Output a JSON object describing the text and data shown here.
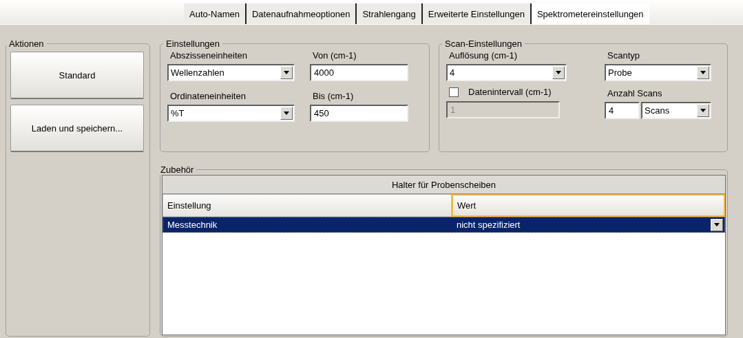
{
  "tabs": [
    {
      "label": "Auto-Namen",
      "selected": false
    },
    {
      "label": "Datenaufnahmeoptionen",
      "selected": false
    },
    {
      "label": "Strahlengang",
      "selected": false
    },
    {
      "label": "Erweiterte Einstellungen",
      "selected": false
    },
    {
      "label": "Spektrometereinstellungen",
      "selected": true
    }
  ],
  "actions": {
    "title": "Aktionen",
    "buttons": [
      "Standard",
      "Laden und speichern..."
    ]
  },
  "einstellungen": {
    "title": "Einstellungen",
    "fields": [
      {
        "kind": "select",
        "label": "Abszisseneinheiten",
        "value": "Wellenzahlen"
      },
      {
        "kind": "input",
        "label": "Von (cm-1)",
        "value": "4000"
      },
      {
        "kind": "select",
        "label": "Ordinateneinheiten",
        "value": "%T"
      },
      {
        "kind": "input",
        "label": "Bis (cm-1)",
        "value": "450"
      }
    ]
  },
  "scan": {
    "title": "Scan-Einstellungen",
    "resolution": {
      "label": "Auflösung (cm-1)",
      "value": "4"
    },
    "interval": {
      "label": "Datenintervall (cm-1)",
      "checked": false,
      "value": "1",
      "disabled": true
    },
    "scantyp": {
      "label": "Scantyp",
      "value": "Probe"
    },
    "count": {
      "label": "Anzahl Scans",
      "value": "4",
      "unit": "Scans"
    }
  },
  "zubehoer": {
    "title": "Zubehör",
    "table": {
      "caption": "Halter für Probenscheiben",
      "columns": [
        "Einstellung",
        "Wert"
      ],
      "rows": [
        {
          "cells": [
            "Messtechnik",
            "nicht spezifiziert"
          ],
          "selected": true
        }
      ]
    }
  }
}
